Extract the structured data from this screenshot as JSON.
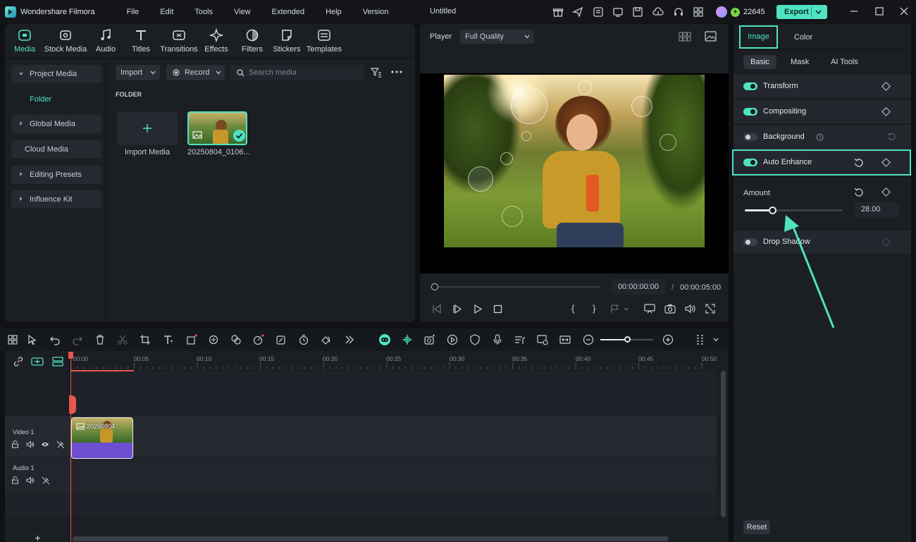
{
  "app": {
    "name": "Wondershare Filmora",
    "document_title": "Untitled",
    "credits": "22645",
    "export_label": "Export"
  },
  "menu": [
    "File",
    "Edit",
    "Tools",
    "View",
    "Extended",
    "Help",
    "Version"
  ],
  "media_tabs": [
    {
      "label": "Media",
      "icon": "media-icon",
      "active": true
    },
    {
      "label": "Stock Media",
      "icon": "stock-media-icon"
    },
    {
      "label": "Audio",
      "icon": "music-note-icon"
    },
    {
      "label": "Titles",
      "icon": "titles-icon"
    },
    {
      "label": "Transitions",
      "icon": "transitions-icon"
    },
    {
      "label": "Effects",
      "icon": "effects-icon"
    },
    {
      "label": "Filters",
      "icon": "filters-icon"
    },
    {
      "label": "Stickers",
      "icon": "stickers-icon"
    },
    {
      "label": "Templates",
      "icon": "templates-icon"
    }
  ],
  "sidebar": {
    "project_media": "Project Media",
    "folder": "Folder",
    "global_media": "Global Media",
    "cloud_media": "Cloud Media",
    "editing_presets": "Editing Presets",
    "influence_kit": "Influence Kit"
  },
  "media_toolbar": {
    "import": "Import",
    "record": "Record",
    "search_placeholder": "Search media"
  },
  "media_grid": {
    "folder_heading": "FOLDER",
    "import_label": "Import Media",
    "clip_name": "20250804_0106..."
  },
  "player": {
    "label": "Player",
    "quality": "Full Quality",
    "current_time": "00:00:00:00",
    "separator": "/",
    "total_time": "00:00:05:00"
  },
  "inspector": {
    "tabs": {
      "image": "Image",
      "color": "Color"
    },
    "subtabs": {
      "basic": "Basic",
      "mask": "Mask",
      "ai_tools": "AI Tools"
    },
    "transform": "Transform",
    "compositing": "Compositing",
    "background": "Background",
    "auto_enhance": "Auto Enhance",
    "amount_label": "Amount",
    "amount_value": "28.00",
    "amount_fraction": 0.28,
    "drop_shadow": "Drop Shadow",
    "reset": "Reset"
  },
  "timeline": {
    "ruler": [
      "00:00",
      "00:05",
      "00:10",
      "00:15",
      "00:20",
      "00:25",
      "00:30",
      "00:35",
      "00:40",
      "00:45",
      "00:50"
    ],
    "video_track": "Video 1",
    "audio_track": "Audio 1",
    "clip_label": "20250804"
  },
  "colors": {
    "accent": "#4fe3c1",
    "panel": "#1b1e23",
    "clip": "#6c4fd1"
  }
}
